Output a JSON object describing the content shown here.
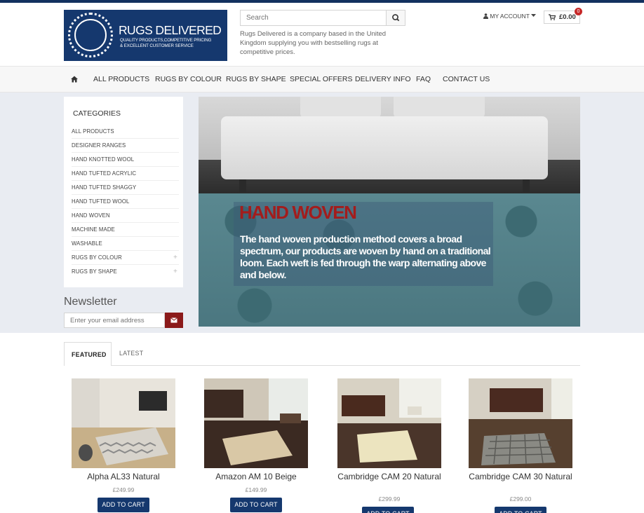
{
  "brand": {
    "title": "RUGS DELIVERED",
    "tagline_1": "QUALITY PRODUCTS,COMPETITIVE PRICING",
    "tagline_2": "& EXCELLENT CUSTOMER SERVICE"
  },
  "search": {
    "placeholder": "Search"
  },
  "company_description": "Rugs Delivered is a company based in the United Kingdom supplying you with bestselling rugs at competitive prices.",
  "account": {
    "label": "MY ACCOUNT"
  },
  "cart": {
    "total": "£0.00",
    "count": "0"
  },
  "nav": {
    "items": [
      "ALL PRODUCTS",
      "RUGS BY COLOUR",
      "RUGS BY SHAPE",
      "SPECIAL OFFERS",
      "DELIVERY INFO",
      "FAQ",
      "CONTACT US"
    ]
  },
  "categories": {
    "title": "CATEGORIES",
    "items": [
      {
        "label": "ALL PRODUCTS",
        "plus": ""
      },
      {
        "label": "DESIGNER RANGES",
        "plus": ""
      },
      {
        "label": "HAND KNOTTED WOOL",
        "plus": ""
      },
      {
        "label": "HAND TUFTED ACRYLIC",
        "plus": ""
      },
      {
        "label": "HAND TUFTED SHAGGY",
        "plus": ""
      },
      {
        "label": "HAND TUFTED WOOL",
        "plus": ""
      },
      {
        "label": "HAND WOVEN",
        "plus": ""
      },
      {
        "label": "MACHINE MADE",
        "plus": ""
      },
      {
        "label": "WASHABLE",
        "plus": ""
      },
      {
        "label": "RUGS BY COLOUR",
        "plus": "+"
      },
      {
        "label": "RUGS BY SHAPE",
        "plus": "+"
      }
    ]
  },
  "newsletter": {
    "title": "Newsletter",
    "placeholder": "Enter your email address"
  },
  "hero": {
    "heading": "HAND WOVEN",
    "text": "The hand woven production method covers a broad spectrum, our products are woven by hand on a traditional loom. Each weft is fed through the warp alternating above and below."
  },
  "tabs": {
    "featured": "FEATURED",
    "latest": "LATEST"
  },
  "products": [
    {
      "name": "Alpha AL33 Natural",
      "price": "£249.99",
      "button": "ADD TO CART"
    },
    {
      "name": "Amazon AM 10 Beige",
      "price": "£149.99",
      "button": "ADD TO CART"
    },
    {
      "name": "Cambridge CAM 20 Natural",
      "price": "£299.99",
      "button": "ADD TO CART"
    },
    {
      "name": "Cambridge CAM 30 Natural",
      "price": "£299.00",
      "button": "ADD TO CART"
    }
  ],
  "colors": {
    "brand_navy": "#15386e",
    "accent_red": "#8b1a1a",
    "hero_heading_red": "#a31c1c"
  }
}
